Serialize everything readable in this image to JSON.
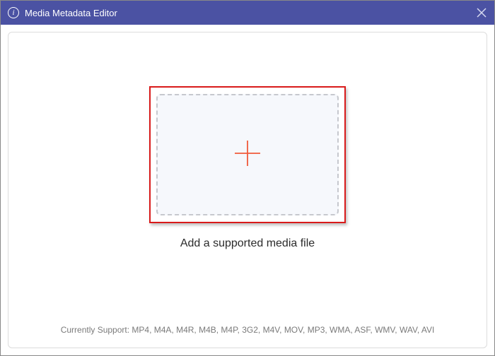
{
  "window": {
    "title": "Media Metadata Editor",
    "info_glyph": "i"
  },
  "main": {
    "drop_label": "Add a supported media file",
    "support_line": "Currently Support: MP4, M4A, M4R, M4B, M4P, 3G2, M4V, MOV, MP3, WMA, ASF, WMV, WAV, AVI"
  }
}
